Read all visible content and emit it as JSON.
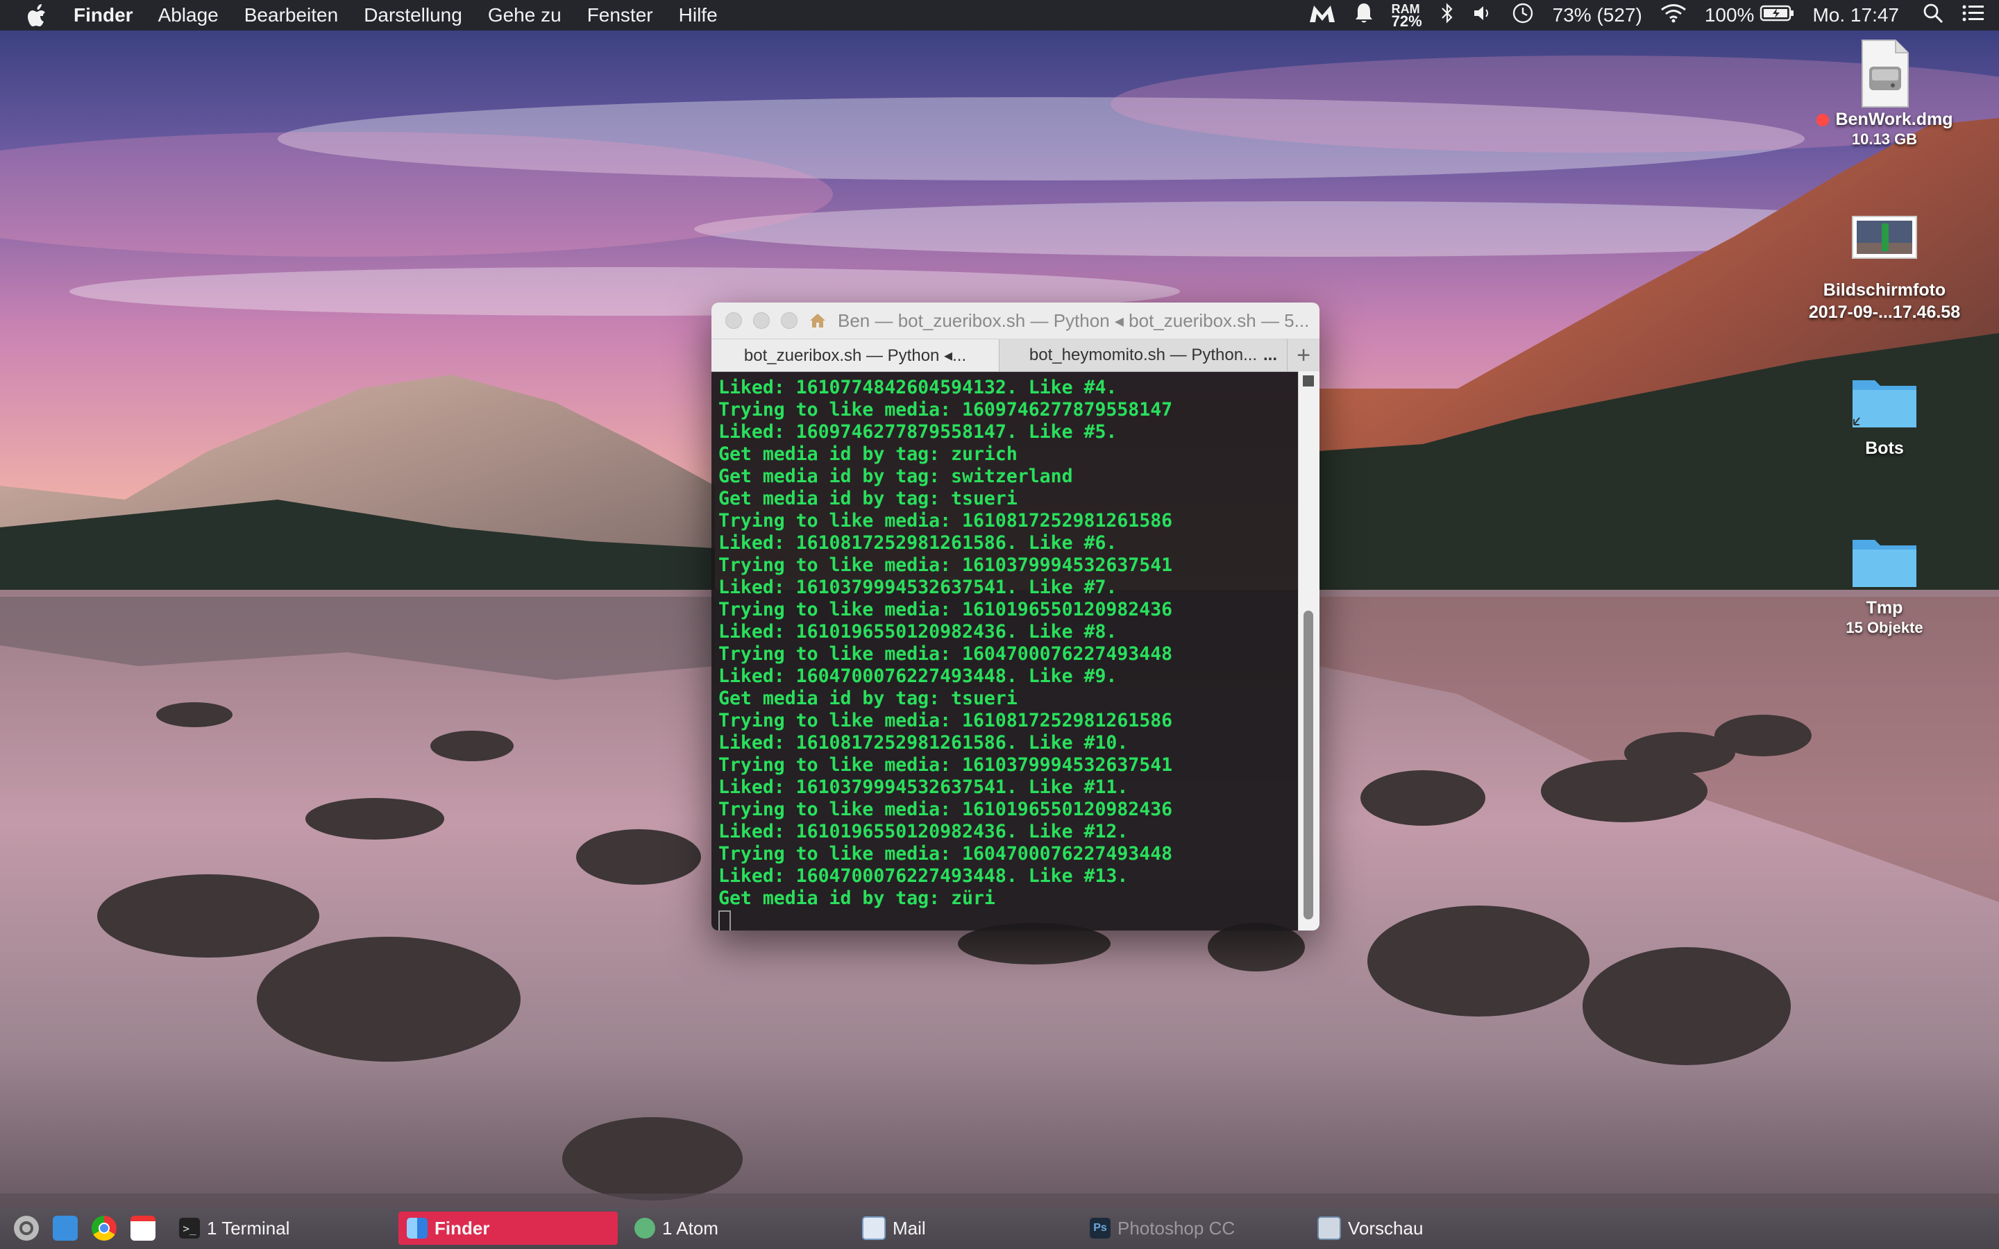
{
  "menubar": {
    "app_name": "Finder",
    "menus": [
      "Ablage",
      "Bearbeiten",
      "Darstellung",
      "Gehe zu",
      "Fenster",
      "Hilfe"
    ],
    "status": {
      "ram_label": "RAM",
      "ram_value": "72%",
      "disk_usage": "73% (527)",
      "battery": "100%",
      "clock": "Mo. 17:47"
    }
  },
  "desktop_icons": [
    {
      "label": "BenWork.dmg",
      "sub": "10.13 GB",
      "icon": "disk-image-icon",
      "tag_color": "#ff4a45"
    },
    {
      "label": "Bildschirmfoto",
      "sub": "2017-09-...17.46.58",
      "icon": "screenshot-icon"
    },
    {
      "label": "Bots",
      "sub": "",
      "icon": "folder-alias-icon"
    },
    {
      "label": "Tmp",
      "sub": "15 Objekte",
      "icon": "folder-icon"
    }
  ],
  "terminal": {
    "title": "Ben — bot_zueribox.sh — Python ◂ bot_zueribox.sh — 5...",
    "tabs": [
      {
        "label": "bot_zueribox.sh — Python ◂...",
        "active": true
      },
      {
        "label": "bot_heymomito.sh — Python...",
        "active": false
      }
    ],
    "tab_more": "...",
    "tab_add": "+",
    "lines": [
      "Liked: 1610774842604594132. Like #4.",
      "Trying to like media: 1609746277879558147",
      "Liked: 1609746277879558147. Like #5.",
      "Get media id by tag: zurich",
      "Get media id by tag: switzerland",
      "Get media id by tag: tsueri",
      "Trying to like media: 1610817252981261586",
      "Liked: 1610817252981261586. Like #6.",
      "Trying to like media: 1610379994532637541",
      "Liked: 1610379994532637541. Like #7.",
      "Trying to like media: 1610196550120982436",
      "Liked: 1610196550120982436. Like #8.",
      "Trying to like media: 1604700076227493448",
      "Liked: 1604700076227493448. Like #9.",
      "Get media id by tag: tsueri",
      "Trying to like media: 1610817252981261586",
      "Liked: 1610817252981261586. Like #10.",
      "Trying to like media: 1610379994532637541",
      "Liked: 1610379994532637541. Like #11.",
      "Trying to like media: 1610196550120982436",
      "Liked: 1610196550120982436. Like #12.",
      "Trying to like media: 1604700076227493448",
      "Liked: 1604700076227493448. Like #13.",
      "Get media id by tag: züri"
    ],
    "text_color": "#29e05c"
  },
  "taskbar": {
    "tasks": [
      {
        "label": "1 Terminal",
        "icon": "terminal-icon",
        "state": "normal"
      },
      {
        "label": "Finder",
        "icon": "finder-icon",
        "state": "active"
      },
      {
        "label": "1 Atom",
        "icon": "atom-icon",
        "state": "normal"
      },
      {
        "label": "Mail",
        "icon": "mail-icon",
        "state": "normal"
      },
      {
        "label": "Photoshop CC",
        "icon": "photoshop-icon",
        "state": "inactive"
      },
      {
        "label": "Vorschau",
        "icon": "preview-icon",
        "state": "normal"
      }
    ],
    "active_color": "#dd2a4f"
  }
}
